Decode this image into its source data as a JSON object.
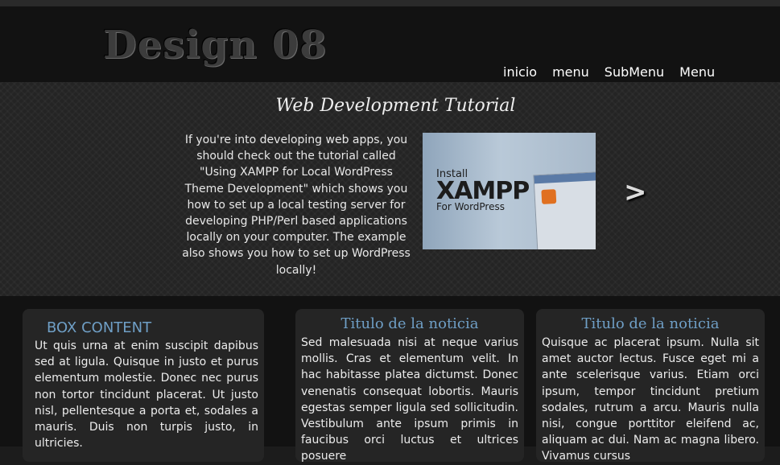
{
  "header": {
    "logo": "Design 08",
    "nav": [
      "inicio",
      "menu",
      "SubMenu",
      "Menu"
    ]
  },
  "hero": {
    "title": "Web Development Tutorial",
    "text": "If you're into developing web apps, you should check out the tutorial called \"Using XAMPP for Local WordPress Theme Development\" which shows you how to set up a local testing server for developing PHP/Perl based applications locally on your computer. The example also shows you how to set up WordPress locally!",
    "image": {
      "line1": "Install",
      "line2": "XAMPP",
      "line3": "For WordPress"
    },
    "next_arrow": ">"
  },
  "boxes": [
    {
      "title": "BOX CONTENT",
      "text": "Ut quis urna at enim suscipit dapibus sed at ligula. Quisque in justo et purus elementum molestie. Donec nec purus non tortor tincidunt placerat. Ut justo nisl, pellentesque a porta et, sodales a mauris. Duis non turpis justo, in ultricies."
    },
    {
      "title": "Titulo de la noticia",
      "text": "Sed malesuada nisi at neque varius mollis. Cras et elementum velit. In hac habitasse platea dictumst. Donec venenatis consequat lobortis. Mauris egestas semper ligula sed sollicitudin. Vestibulum ante ipsum primis in faucibus orci luctus et ultrices posuere"
    },
    {
      "title": "Titulo de la noticia",
      "text": "Quisque ac placerat ipsum. Nulla sit amet auctor lectus. Fusce eget mi a ante scelerisque varius. Etiam orci ipsum, tempor tincidunt pretium sodales, rutrum a arcu. Mauris nulla nisi, congue porttitor eleifend ac, aliquam ac dui. Nam ac magna libero. Vivamus cursus"
    }
  ]
}
